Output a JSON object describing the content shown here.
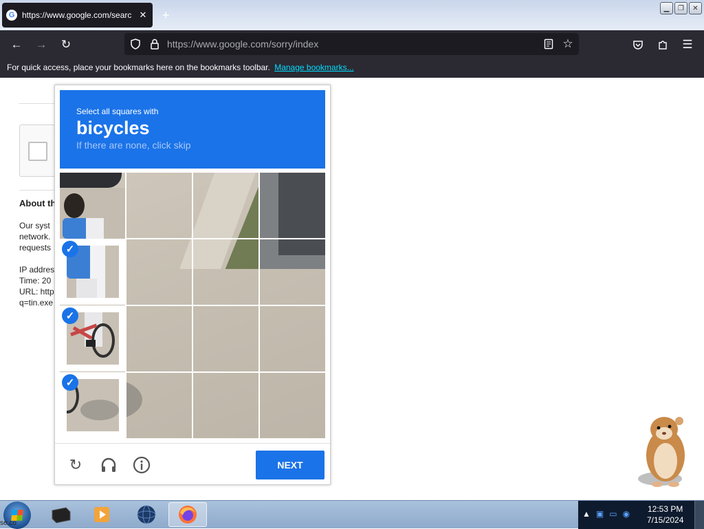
{
  "browser": {
    "tab_title": "https://www.google.com/searc",
    "new_tab": "+",
    "url": "https://www.google.com/sorry/index",
    "bookmarks_prompt": "For quick access, place your bookmarks here on the bookmarks toolbar.",
    "manage_bookmarks": "Manage bookmarks..."
  },
  "page": {
    "about_title": "About th",
    "about_lines": [
      "Our syst",
      "network.",
      "requests"
    ],
    "info_lines": [
      "IP addres",
      "Time: 20",
      "URL: http",
      "q=tin.exe"
    ]
  },
  "captcha": {
    "instruction": "Select all squares with",
    "keyword": "bicycles",
    "subtext": "If there are none, click skip",
    "next_label": "NEXT",
    "selected_tiles": [
      4,
      8,
      12
    ]
  },
  "taskbar": {
    "start_label": "se.co",
    "time": "12:53 PM",
    "date": "7/15/2024"
  },
  "colors": {
    "captcha_blue": "#1a73e8",
    "browser_dark": "#2b2a33",
    "link_cyan": "#00ddff"
  }
}
